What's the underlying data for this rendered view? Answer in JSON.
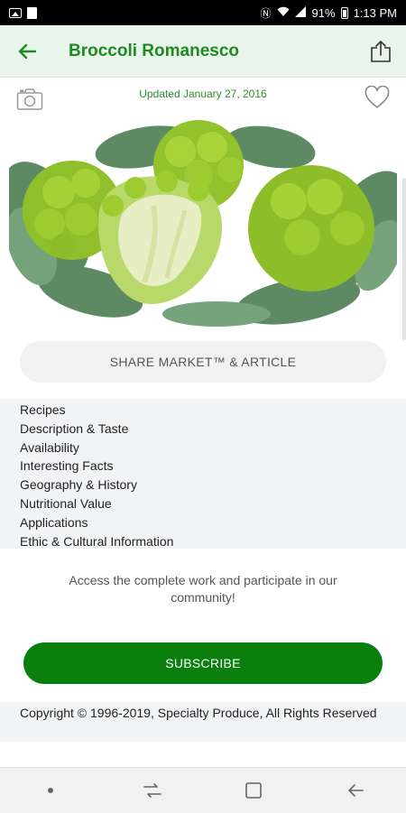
{
  "status_bar": {
    "battery": "91%",
    "time": "1:13 PM"
  },
  "app_bar": {
    "title": "Broccoli Romanesco"
  },
  "hero": {
    "updated": "Updated January 27, 2016"
  },
  "share_button_label": "SHARE MARKET™ & ARTICLE",
  "sections": [
    "Recipes",
    "Description & Taste",
    "Availability",
    "Interesting Facts",
    "Geography & History",
    "Nutritional Value",
    "Applications",
    "Ethic & Cultural Information"
  ],
  "access_text": "Access the complete work and participate in our community!",
  "subscribe_label": "SUBSCRIBE",
  "copyright": "Copyright © 1996-2019, Specialty Produce, All Rights Reserved",
  "icons": {
    "back": "arrow-left-icon",
    "share": "share-upload-icon",
    "camera": "camera-icon",
    "favorite": "heart-outline-icon"
  },
  "colors": {
    "brand_green": "#1e8a22",
    "subscribe_green": "#0b7f0e",
    "app_bar_bg": "#e9f5ea"
  }
}
